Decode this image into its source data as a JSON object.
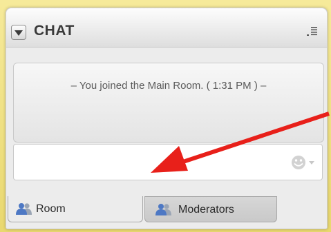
{
  "chat": {
    "title": "CHAT",
    "messages": [
      "– You joined the Main Room. ( 1:31 PM ) –"
    ],
    "input": {
      "value": "",
      "placeholder": ""
    }
  },
  "tabs": [
    {
      "label": "Room",
      "active": true
    },
    {
      "label": "Moderators",
      "active": false
    }
  ],
  "icons": {
    "collapse": "triangle-down-icon",
    "menu": "list-menu-icon",
    "emoji": "smiley-icon",
    "tab_icon": "users-icon"
  },
  "colors": {
    "frame": "#efe08a",
    "panel": "#ececec",
    "annotation_arrow": "#e8201a"
  }
}
